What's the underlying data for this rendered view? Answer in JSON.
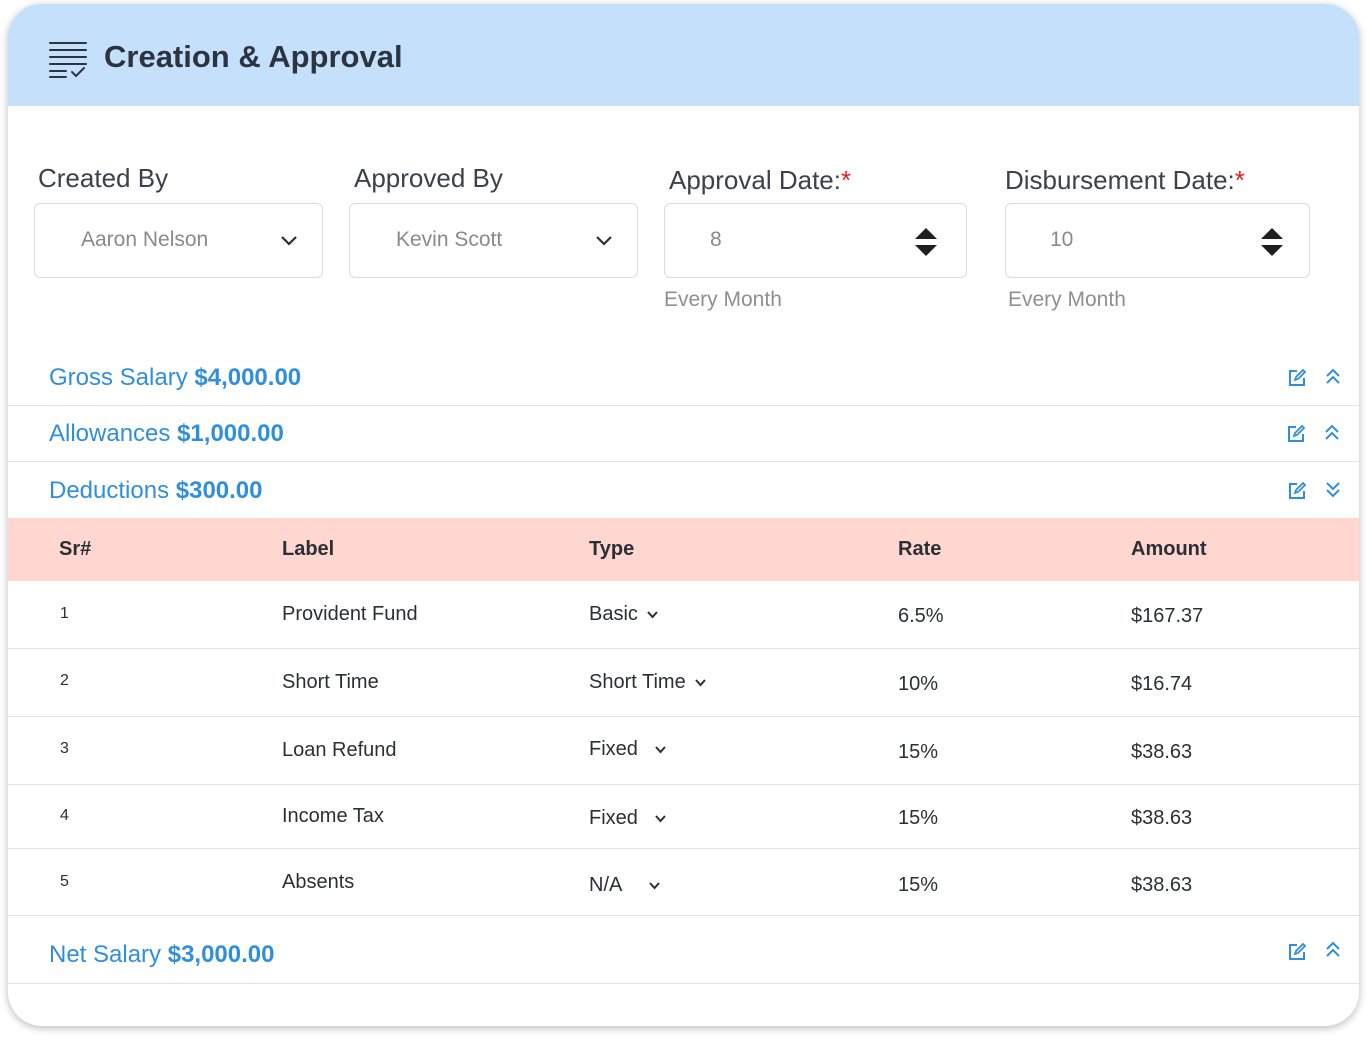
{
  "header": {
    "title": "Creation & Approval",
    "icon": "checklist-icon"
  },
  "fields": {
    "created_by": {
      "label": "Created By",
      "value": "Aaron Nelson"
    },
    "approved_by": {
      "label": "Approved By",
      "value": "Kevin Scott"
    },
    "approval_date": {
      "label": "Approval Date:",
      "required": "*",
      "value": "8",
      "hint": "Every Month"
    },
    "disbursement_date": {
      "label": "Disbursement Date:",
      "required": "*",
      "value": "10",
      "hint": "Every Month"
    }
  },
  "sections": {
    "gross": {
      "label": "Gross Salary",
      "amount": "$4,000.00",
      "state": "expanded"
    },
    "allowances": {
      "label": "Allowances",
      "amount": "$1,000.00",
      "state": "expanded"
    },
    "deductions": {
      "label": "Deductions",
      "amount": "$300.00",
      "state": "collapsed"
    },
    "net": {
      "label": "Net Salary",
      "amount": "$3,000.00",
      "state": "expanded"
    }
  },
  "table": {
    "headers": {
      "sr": "Sr#",
      "label": "Label",
      "type": "Type",
      "rate": "Rate",
      "amount": "Amount"
    },
    "rows": [
      {
        "sr": "1",
        "label": "Provident Fund",
        "type": "Basic",
        "rate": "6.5%",
        "amount": "$167.37"
      },
      {
        "sr": "2",
        "label": "Short Time",
        "type": "Short Time",
        "rate": "10%",
        "amount": "$16.74"
      },
      {
        "sr": "3",
        "label": "Loan Refund",
        "type": "Fixed",
        "rate": "15%",
        "amount": "$38.63"
      },
      {
        "sr": "4",
        "label": "Income Tax",
        "type": "Fixed",
        "rate": "15%",
        "amount": "$38.63"
      },
      {
        "sr": "5",
        "label": "Absents",
        "type": "N/A",
        "rate": "15%",
        "amount": "$38.63"
      }
    ]
  },
  "colors": {
    "header_bg": "#c5e0fb",
    "accent": "#2f8fde",
    "table_header_bg": "#ffd6d0",
    "required": "#e02020"
  }
}
